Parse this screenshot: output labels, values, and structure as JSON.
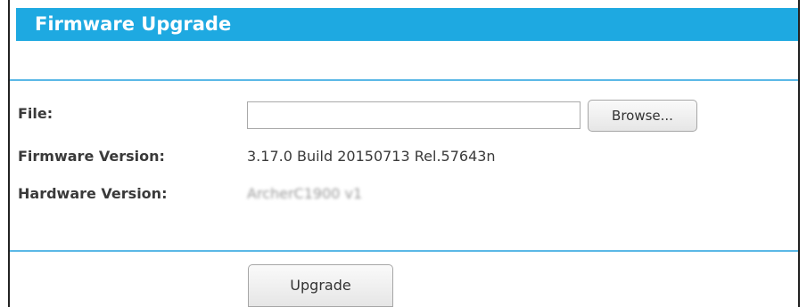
{
  "header": {
    "title": "Firmware Upgrade"
  },
  "form": {
    "file_label": "File:",
    "file_value": "",
    "browse_label": "Browse...",
    "firmware_label": "Firmware Version:",
    "firmware_value": "3.17.0 Build 20150713 Rel.57643n",
    "hardware_label": "Hardware Version:",
    "hardware_value": "ArcherC1900 v1",
    "upgrade_label": "Upgrade"
  },
  "colors": {
    "header_background": "#1ea9e1",
    "header_text": "#ffffff",
    "divider": "#5bb8e6"
  }
}
